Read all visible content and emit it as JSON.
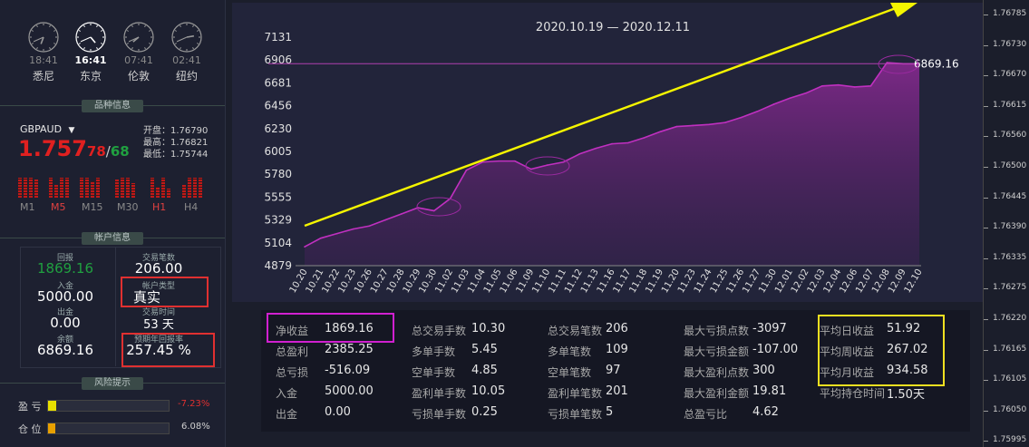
{
  "clocks": [
    {
      "time": "18:41",
      "city": "悉尼",
      "active": false,
      "hour": 18,
      "minute": 41
    },
    {
      "time": "16:41",
      "city": "东京",
      "active": true,
      "hour": 16,
      "minute": 41
    },
    {
      "time": "07:41",
      "city": "伦敦",
      "active": false,
      "hour": 7,
      "minute": 41
    },
    {
      "time": "02:41",
      "city": "纽约",
      "active": false,
      "hour": 2,
      "minute": 41
    }
  ],
  "sections": {
    "instrument": "品种信息",
    "account": "帐户信息",
    "risk": "风险提示"
  },
  "instrument": {
    "symbol": "GBPAUD",
    "price_main": "1.757",
    "price_big": "78",
    "sep": "/",
    "price_small": "68",
    "open_label": "开盘：",
    "open": "1.76790",
    "high_label": "最高：",
    "high": "1.76821",
    "low_label": "最低：",
    "low": "1.75744"
  },
  "timeframes": [
    "M1",
    "M5",
    "M15",
    "M30",
    "H1",
    "H4"
  ],
  "account": {
    "return_label": "回报",
    "return_value": "1869.16",
    "trades_label": "交易笔数",
    "trades_value": "206.00",
    "deposit_label": "入金",
    "deposit_value": "5000.00",
    "type_label": "帐户类型",
    "type_value": "真实",
    "withdraw_label": "出金",
    "withdraw_value": "0.00",
    "time_label": "交易时间",
    "time_value": "53 天",
    "balance_label": "余额",
    "balance_value": "6869.16",
    "annual_label": "预期年回报率",
    "annual_value": "257.45 %"
  },
  "risk": {
    "pl_label": "盈 亏",
    "pl_value": "-7.23%",
    "pl_level": 0.07,
    "pos_label": "仓 位",
    "pos_value": "6.08%",
    "pos_level": 0.06
  },
  "chart_data": {
    "type": "area",
    "title": "2020.10.19 — 2020.12.11",
    "yticks": [
      4879,
      5104,
      5329,
      5555,
      5780,
      6005,
      6230,
      6456,
      6681,
      6906,
      7131
    ],
    "ylim": [
      4879,
      7131
    ],
    "categories": [
      "10.20",
      "10.21",
      "10.22",
      "10.23",
      "10.26",
      "10.27",
      "10.28",
      "10.29",
      "10.30",
      "11.02",
      "11.03",
      "11.04",
      "11.05",
      "11.06",
      "11.09",
      "11.10",
      "11.11",
      "11.12",
      "11.13",
      "11.16",
      "11.17",
      "11.18",
      "11.19",
      "11.20",
      "11.23",
      "11.24",
      "11.25",
      "11.26",
      "11.27",
      "11.30",
      "12.01",
      "12.02",
      "12.03",
      "12.04",
      "12.06",
      "12.07",
      "12.08",
      "12.09",
      "12.10"
    ],
    "values": [
      5065,
      5150,
      5195,
      5240,
      5270,
      5330,
      5390,
      5450,
      5420,
      5540,
      5820,
      5900,
      5910,
      5910,
      5830,
      5870,
      5900,
      5980,
      6035,
      6080,
      6090,
      6140,
      6200,
      6250,
      6260,
      6270,
      6290,
      6340,
      6400,
      6470,
      6530,
      6580,
      6650,
      6660,
      6640,
      6650,
      6880,
      6869,
      6869
    ],
    "last_label": "6869.16",
    "ref_value": 6869.16
  },
  "right_axis": [
    "1.76785",
    "1.76730",
    "1.76670",
    "1.76615",
    "1.76560",
    "1.76500",
    "1.76445",
    "1.76390",
    "1.76335",
    "1.76275",
    "1.76220",
    "1.76165",
    "1.76105",
    "1.76050",
    "1.75995"
  ],
  "stats": [
    [
      {
        "label": "净收益",
        "value": "1869.16"
      },
      {
        "label": "总盈利",
        "value": "2385.25"
      },
      {
        "label": "总亏损",
        "value": "-516.09"
      },
      {
        "label": "入金",
        "value": "5000.00"
      },
      {
        "label": "出金",
        "value": "0.00"
      }
    ],
    [
      {
        "label": "总交易手数",
        "value": "10.30"
      },
      {
        "label": "多单手数",
        "value": "5.45"
      },
      {
        "label": "空单手数",
        "value": "4.85"
      },
      {
        "label": "盈利单手数",
        "value": "10.05"
      },
      {
        "label": "亏损单手数",
        "value": "0.25"
      }
    ],
    [
      {
        "label": "总交易笔数",
        "value": "206"
      },
      {
        "label": "多单笔数",
        "value": "109"
      },
      {
        "label": "空单笔数",
        "value": "97"
      },
      {
        "label": "盈利单笔数",
        "value": "201"
      },
      {
        "label": "亏损单笔数",
        "value": "5"
      }
    ],
    [
      {
        "label": "最大亏损点数",
        "value": "-3097"
      },
      {
        "label": "最大亏损金额",
        "value": "-107.00"
      },
      {
        "label": "最大盈利点数",
        "value": "300"
      },
      {
        "label": "最大盈利金额",
        "value": "19.81"
      },
      {
        "label": "总盈亏比",
        "value": "4.62"
      }
    ],
    [
      {
        "label": "平均日收益",
        "value": "51.92"
      },
      {
        "label": "平均周收益",
        "value": "267.02"
      },
      {
        "label": "平均月收益",
        "value": "934.58"
      },
      {
        "label": "平均持仓时间",
        "value": "1.50天"
      }
    ]
  ],
  "colors": {
    "accent": "#c030c0",
    "up": "#20a040",
    "down": "#e02020",
    "highlight_red": "#e03030",
    "highlight_yellow": "#f0e020",
    "arrow": "#f5f500"
  }
}
